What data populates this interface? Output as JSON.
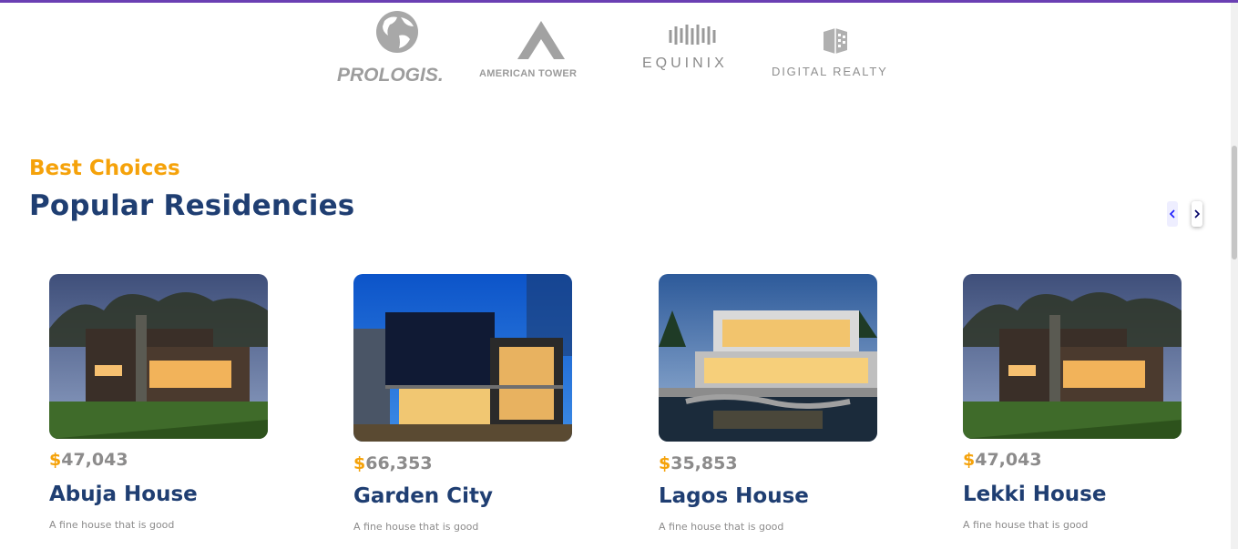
{
  "partners": [
    {
      "name": "PROLOGIS.",
      "icon": "globe-icon"
    },
    {
      "name": "AMERICAN TOWER",
      "icon": "tower-icon"
    },
    {
      "name": "EQUINIX",
      "icon": "equinix-wave-icon"
    },
    {
      "name": "DIGITAL REALTY",
      "icon": "cube-icon"
    }
  ],
  "section": {
    "eyebrow": "Best Choices",
    "title": "Popular Residencies"
  },
  "carousel": {
    "prev_icon": "chevron-left-icon",
    "next_icon": "chevron-right-icon"
  },
  "cards": [
    {
      "currency": "$",
      "price": "47,043",
      "name": "Abuja House",
      "description": "A fine house that is good"
    },
    {
      "currency": "$",
      "price": "66,353",
      "name": "Garden City",
      "description": "A fine house that is good"
    },
    {
      "currency": "$",
      "price": "35,853",
      "name": "Lagos House",
      "description": "A fine house that is good"
    },
    {
      "currency": "$",
      "price": "47,043",
      "name": "Lekki House",
      "description": "A fine house that is good"
    }
  ],
  "colors": {
    "accent": "#f5a20a",
    "heading": "#1f3e72",
    "muted": "#8c8b8b",
    "topbar": "#6a3fb3"
  }
}
